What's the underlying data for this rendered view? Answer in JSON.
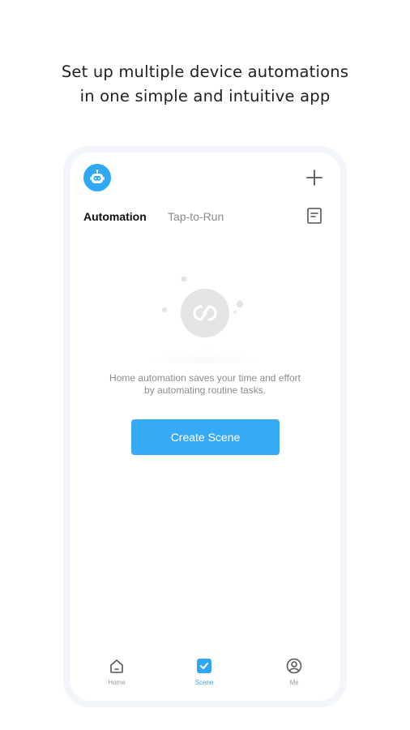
{
  "headline": {
    "line1": "Set up multiple device automations",
    "line2": "in one simple and intuitive app"
  },
  "header": {
    "assistant_icon": "robot-icon",
    "add_icon": "plus-icon",
    "log_icon": "document-icon"
  },
  "tabs": [
    {
      "label": "Automation",
      "active": true
    },
    {
      "label": "Tap-to-Run",
      "active": false
    }
  ],
  "empty_state": {
    "illustration_icon": "automation-cycle-icon",
    "line1": "Home automation saves your time and effort",
    "line2": "by automating routine tasks.",
    "button_label": "Create Scene"
  },
  "tab_bar": [
    {
      "label": "Home",
      "icon": "home-icon",
      "active": false
    },
    {
      "label": "Scene",
      "icon": "scene-check-icon",
      "active": true
    },
    {
      "label": "Me",
      "icon": "profile-icon",
      "active": false
    }
  ],
  "colors": {
    "accent": "#2ea8f5",
    "button": "#36aaf4",
    "phone_frame": "#f2f6fb",
    "muted_text": "#8c8c8c"
  }
}
